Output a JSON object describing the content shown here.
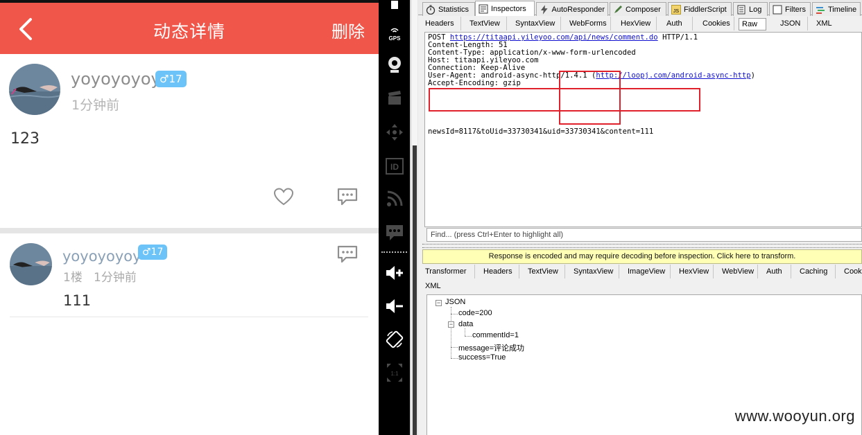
{
  "phone": {
    "header": {
      "title": "动态详情",
      "delete_label": "删除"
    },
    "post": {
      "username": "yoyoyoyoy",
      "gender_badge": "♂17",
      "time": "1分钟前",
      "content": "123"
    },
    "comment": {
      "username": "yoyoyoyoy",
      "gender_badge": "♂17",
      "floor_time": "1楼   1分钟前",
      "content": "111"
    },
    "colors": {
      "header": "#f0564a",
      "badge": "#6bc3f7"
    }
  },
  "emulator": {
    "gps_label": "GPS",
    "id_label": "ID",
    "ratio_label": "1:1",
    "icons": [
      "battery-icon",
      "gps-icon",
      "webcam-icon",
      "clapper-icon",
      "move-icon",
      "id-icon",
      "rss-icon",
      "sms-icon",
      "volume-up-icon",
      "volume-down-icon",
      "rotate-icon",
      "ratio-icon"
    ]
  },
  "fiddler": {
    "top_tabs": [
      "Statistics",
      "Inspectors",
      "AutoResponder",
      "Composer",
      "FiddlerScript",
      "Log",
      "Filters",
      "Timeline"
    ],
    "active_top_tab": "Inspectors",
    "request_tabs": [
      "Headers",
      "TextView",
      "SyntaxView",
      "WebForms",
      "HexView",
      "Auth",
      "Cookies",
      "Raw",
      "JSON",
      "XML"
    ],
    "active_request_tab": "Raw",
    "raw": {
      "method": "POST",
      "url": "https://titaapi.yileyoo.com/api/news/comment.do",
      "protocol": "HTTP/1.1",
      "content_length": "Content-Length: 51",
      "content_type": "Content-Type: application/x-www-form-urlencoded",
      "host": "Host: titaapi.yileyoo.com",
      "connection": "Connection: Keep-Alive",
      "user_agent_prefix": "User-Agent: android-async-http/1.4.1 (",
      "user_agent_link": "http://loopj.com/android-async-http",
      "user_agent_suffix": ")",
      "accept_encoding": "Accept-Encoding: gzip",
      "body": "newsId=8117&toUid=33730341&uid=33730341&content=111"
    },
    "find_placeholder": "Find... (press Ctrl+Enter to highlight all)",
    "warning": "Response is encoded and may require decoding before inspection. Click here to transform.",
    "response_tabs": [
      "Transformer",
      "Headers",
      "TextView",
      "SyntaxView",
      "ImageView",
      "HexView",
      "WebView",
      "Auth",
      "Caching",
      "Cookies"
    ],
    "response_tab_xml": "XML",
    "tree": {
      "root": "JSON",
      "code": "code=200",
      "data": "data",
      "comment_id": "commentId=1",
      "message": "message=评论成功",
      "success": "success=True"
    },
    "highlight_color": "#e0202a"
  },
  "watermark": "www.wooyun.org"
}
